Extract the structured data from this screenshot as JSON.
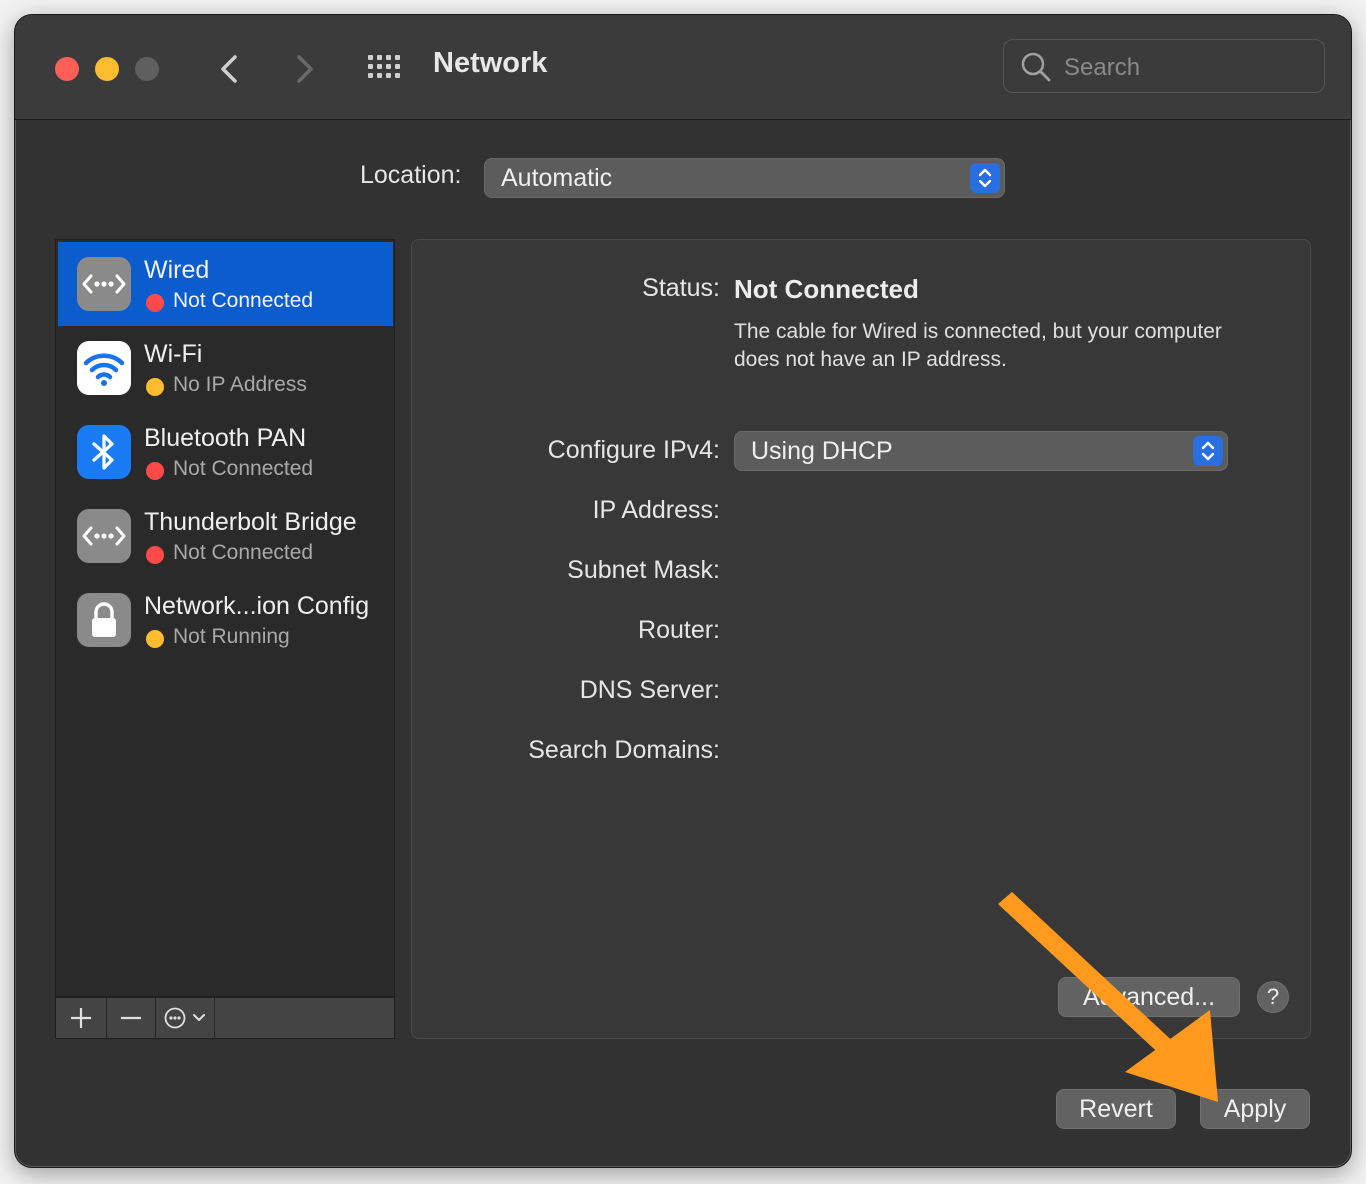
{
  "window": {
    "title": "Network",
    "search_placeholder": "Search"
  },
  "location": {
    "label": "Location:",
    "value": "Automatic"
  },
  "services": [
    {
      "name": "Wired",
      "status": "Not Connected",
      "status_color": "#fe4a49",
      "icon": "ethernet-icon",
      "selected": true
    },
    {
      "name": "Wi-Fi",
      "status": "No IP Address",
      "status_color": "#febc2e",
      "icon": "wifi-icon",
      "selected": false
    },
    {
      "name": "Bluetooth PAN",
      "status": "Not Connected",
      "status_color": "#fe4a49",
      "icon": "bluetooth-icon",
      "selected": false
    },
    {
      "name": "Thunderbolt Bridge",
      "status": "Not Connected",
      "status_color": "#fe4a49",
      "icon": "ethernet-icon",
      "selected": false
    },
    {
      "name": "Network...ion Config",
      "status": "Not Running",
      "status_color": "#febc2e",
      "icon": "lock-icon",
      "selected": false
    }
  ],
  "detail": {
    "status_label": "Status:",
    "status_value": "Not Connected",
    "status_description": "The cable for Wired is connected, but your computer does not have an IP address.",
    "configure_label": "Configure IPv4:",
    "configure_value": "Using DHCP",
    "ip_label": "IP Address:",
    "subnet_label": "Subnet Mask:",
    "router_label": "Router:",
    "dns_label": "DNS Server:",
    "search_domains_label": "Search Domains:",
    "advanced_label": "Advanced...",
    "help_label": "?"
  },
  "footer": {
    "revert_label": "Revert",
    "apply_label": "Apply"
  },
  "colors": {
    "accent": "#0b5ccd",
    "annotation_arrow": "#ff9a1f"
  }
}
